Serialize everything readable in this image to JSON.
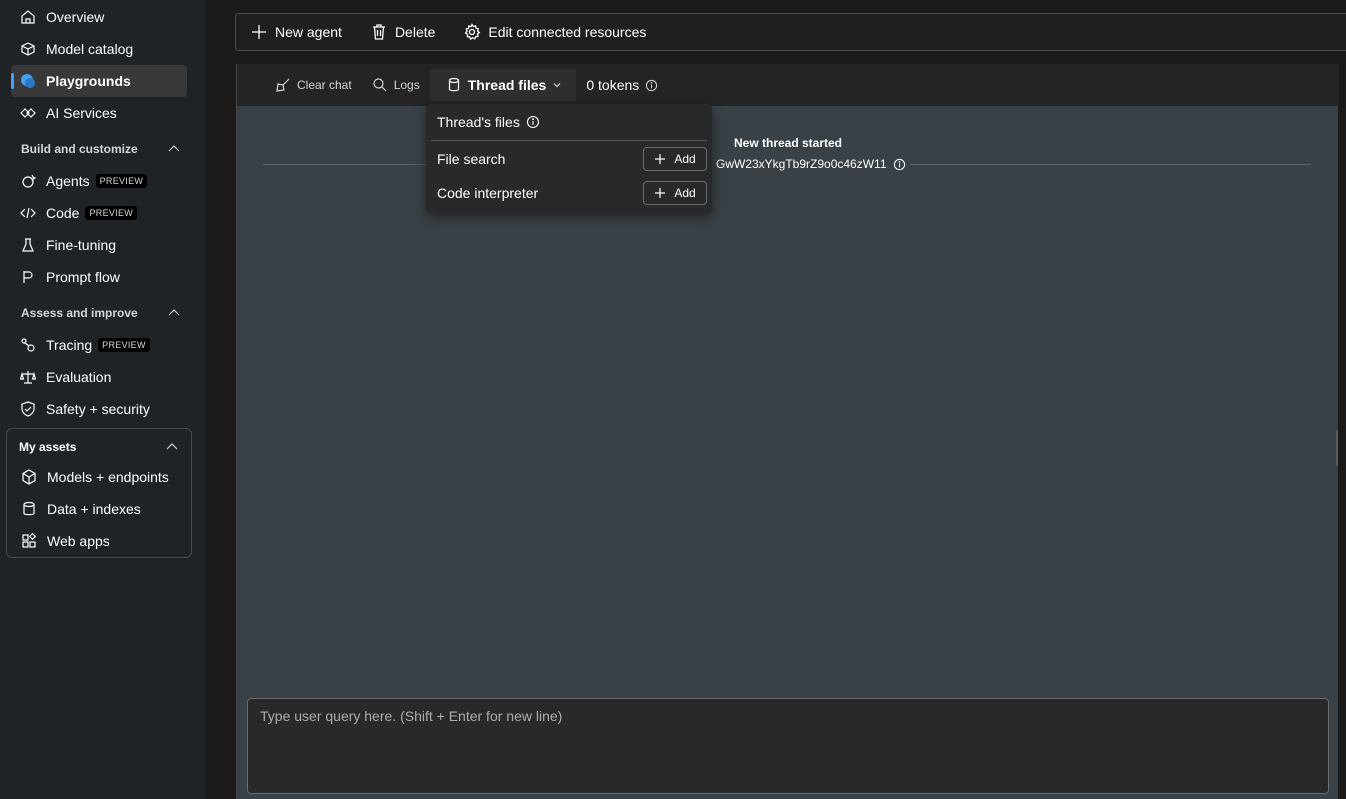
{
  "sidebar": {
    "top_items": [
      {
        "label": "Overview",
        "icon": "home-icon"
      },
      {
        "label": "Model catalog",
        "icon": "cube-icon"
      },
      {
        "label": "Playgrounds",
        "icon": "chat-icon",
        "active": true
      },
      {
        "label": "AI Services",
        "icon": "services-icon"
      }
    ],
    "build_section": {
      "title": "Build and customize",
      "items": [
        {
          "label": "Agents",
          "badge": "PREVIEW",
          "icon": "agent-icon"
        },
        {
          "label": "Code",
          "badge": "PREVIEW",
          "icon": "code-icon"
        },
        {
          "label": "Fine-tuning",
          "icon": "beaker-icon"
        },
        {
          "label": "Prompt flow",
          "icon": "flow-icon"
        }
      ]
    },
    "assess_section": {
      "title": "Assess and improve",
      "items": [
        {
          "label": "Tracing",
          "badge": "PREVIEW",
          "icon": "tracing-icon"
        },
        {
          "label": "Evaluation",
          "icon": "scale-icon"
        },
        {
          "label": "Safety + security",
          "icon": "shield-icon"
        }
      ]
    },
    "assets_section": {
      "title": "My assets",
      "items": [
        {
          "label": "Models + endpoints",
          "icon": "model-icon"
        },
        {
          "label": "Data + indexes",
          "icon": "database-icon"
        },
        {
          "label": "Web apps",
          "icon": "apps-icon"
        }
      ]
    }
  },
  "toolbar": {
    "new_agent": "New agent",
    "delete": "Delete",
    "edit_resources": "Edit connected resources"
  },
  "chat_toolbar": {
    "clear_chat": "Clear chat",
    "logs": "Logs",
    "thread_files": "Thread files",
    "tokens_count": "0",
    "tokens_label": "tokens"
  },
  "thread": {
    "title": "New thread started",
    "id": "GwW23xYkgTb9rZ9o0c46zW11"
  },
  "popover": {
    "title": "Thread's files",
    "rows": [
      {
        "label": "File search",
        "button": "Add"
      },
      {
        "label": "Code interpreter",
        "button": "Add"
      }
    ]
  },
  "query": {
    "placeholder": "Type user query here. (Shift + Enter for new line)"
  },
  "colors": {
    "accent": "#479ef5",
    "sidebar_bg": "#1f2326",
    "chat_bg": "#3a4146"
  }
}
